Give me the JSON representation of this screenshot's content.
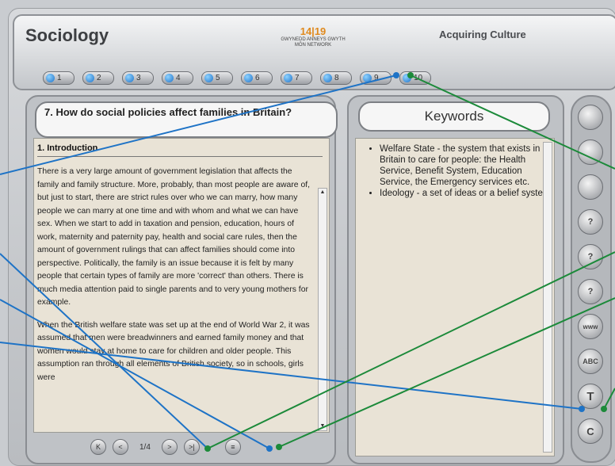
{
  "header": {
    "app_title": "Sociology",
    "logo_number": "14|19",
    "logo_line1": "GWYNEDD ANNEYS GWYTH",
    "logo_line2": "MÔN NETWORK",
    "topic": "Acquiring Culture"
  },
  "page_buttons": [
    "1",
    "2",
    "3",
    "4",
    "5",
    "6",
    "7",
    "8",
    "9",
    "10"
  ],
  "question": {
    "title": "7. How do social policies affect families in Britain?"
  },
  "content": {
    "section_heading": "1. Introduction",
    "paragraph1": "There is a very large amount of government legislation that affects the family and family structure. More, probably, than most people are aware of, but just to start, there are strict rules over who we can marry, how many people we can marry at one time and with whom and what we can have sex. When we start to add in taxation and pension, education, hours of work, maternity and paternity pay, health and social care rules, then the amount of government rulings that can affect families should come into perspective. Politically, the family is an issue because it is felt by many people that certain types of family are more 'correct' than others. There is much media attention paid to single parents and to very young mothers for example.",
    "paragraph2": "When the British welfare state was set up at the end of World War 2, it was assumed that men were breadwinners and earned family money and that women would stay at home to care for children and older people. This assumption ran through all elements of British society, so in schools, girls were"
  },
  "navigation": {
    "page_count": "1/4",
    "first_label": "K",
    "prev_label": "<",
    "next_label": ">",
    "last_label": ">|",
    "menu_label": "≡"
  },
  "keywords": {
    "title": "Keywords",
    "items": [
      "Welfare State - the system that exists in Britain to care for people: the Health Service, Benefit System, Education Service, the Emergency services etc.",
      "Ideology - a set of ideas or a belief system."
    ]
  },
  "tools": {
    "items": [
      {
        "label": "",
        "icon": "notes-icon"
      },
      {
        "label": "",
        "icon": "key-icon"
      },
      {
        "label": "",
        "icon": "clapper-icon"
      },
      {
        "label": "?",
        "icon": "question-icon"
      },
      {
        "label": "?",
        "icon": "question-small-icon"
      },
      {
        "label": "?",
        "icon": "question-person-icon"
      },
      {
        "label": "www",
        "icon": "www-icon"
      },
      {
        "label": "ABC",
        "icon": "abc-icon"
      },
      {
        "label": "T",
        "icon": "text-icon"
      },
      {
        "label": "C",
        "icon": "c-icon"
      }
    ]
  },
  "colors": {
    "accent_blue": "#1f73c9",
    "annotation_blue": "#1e73c6",
    "annotation_green": "#1c8a3a",
    "panel_bg": "#e9e3d6"
  }
}
